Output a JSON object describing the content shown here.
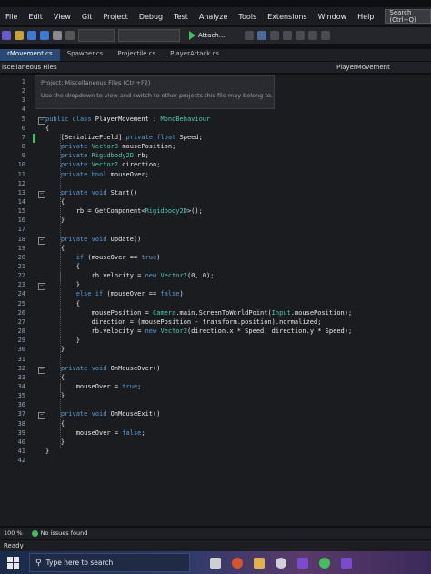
{
  "menu": {
    "items": [
      "File",
      "Edit",
      "View",
      "Git",
      "Project",
      "Debug",
      "Test",
      "Analyze",
      "Tools",
      "Extensions",
      "Window",
      "Help"
    ],
    "search_placeholder": "Search (Ctrl+Q)"
  },
  "toolbar": {
    "attach_label": "Attach...",
    "accent_green": "#3fbf5a"
  },
  "tabs": [
    {
      "label": "rMovement.cs",
      "active": true
    },
    {
      "label": "Spawner.cs",
      "active": false
    },
    {
      "label": "Projectile.cs",
      "active": false
    },
    {
      "label": "PlayerAttack.cs",
      "active": false
    }
  ],
  "navbar": {
    "project": "iscellaneous Files",
    "member": "PlayerMovement"
  },
  "tooltip": {
    "title": "Project: Miscellaneous Files (Ctrl+F2)",
    "body": "Use the dropdown to view and switch to other projects this file may belong to."
  },
  "code": {
    "line_numbers": [
      "1",
      "2",
      "3",
      "4",
      "5",
      "6",
      "7",
      "8",
      "9",
      "10",
      "11",
      "12",
      "13",
      "14",
      "15",
      "16",
      "17",
      "18",
      "19",
      "20",
      "21",
      "22",
      "23",
      "24",
      "25",
      "26",
      "27",
      "28",
      "29",
      "30",
      "31",
      "32",
      "33",
      "34",
      "35",
      "36",
      "37",
      "38",
      "39",
      "40",
      "41",
      "42"
    ],
    "lines": [
      "",
      "",
      "",
      "",
      "public class PlayerMovement : MonoBehaviour",
      "{",
      "    [SerializeField] private float Speed;",
      "    private Vector3 mousePosition;",
      "    private Rigidbody2D rb;",
      "    private Vector2 direction;",
      "    private bool mouseOver;",
      "",
      "    private void Start()",
      "    {",
      "        rb = GetComponent<Rigidbody2D>();",
      "    }",
      "",
      "    private void Update()",
      "    {",
      "        if (mouseOver == true)",
      "        {",
      "            rb.velocity = new Vector2(0, 0);",
      "        }",
      "        else if (mouseOver == false)",
      "        {",
      "            mousePosition = Camera.main.ScreenToWorldPoint(Input.mousePosition);",
      "            direction = (mousePosition - transform.position).normalized;",
      "            rb.velocity = new Vector2(direction.x * Speed, direction.y * Speed);",
      "        }",
      "    }",
      "",
      "    private void OnMouseOver()",
      "    {",
      "        mouseOver = true;",
      "    }",
      "",
      "    private void OnMouseExit()",
      "    {",
      "        mouseOver = false;",
      "    }",
      "}",
      ""
    ]
  },
  "status": {
    "zoom": "100 %",
    "issues": "No issues found",
    "ready": "Ready"
  },
  "taskbar": {
    "search_placeholder": "Type here to search"
  }
}
